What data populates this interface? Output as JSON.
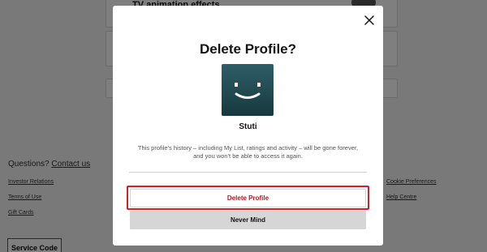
{
  "background": {
    "setting_label": "TV animation effects",
    "footer": {
      "questions_prefix": "Questions?",
      "contact_link": "Contact us",
      "links_left": [
        "Investor Relations",
        "Terms of Use",
        "Gift Cards"
      ],
      "links_right": [
        "Cookie Preferences",
        "Help Centre"
      ],
      "service_code": "Service Code"
    }
  },
  "modal": {
    "title": "Delete Profile?",
    "avatar_icon": "smiley-face-icon",
    "profile_name": "Stuti",
    "warning_text": "This profile's history – including My List, ratings and activity – will be gone forever, and you won't be able to access it again.",
    "delete_button": "Delete Profile",
    "cancel_button": "Never Mind",
    "close_icon": "close-icon"
  },
  "colors": {
    "delete_text": "#c11119",
    "highlight_border": "#d32027",
    "avatar_top": "#2e5e66",
    "avatar_bottom": "#17383f"
  }
}
